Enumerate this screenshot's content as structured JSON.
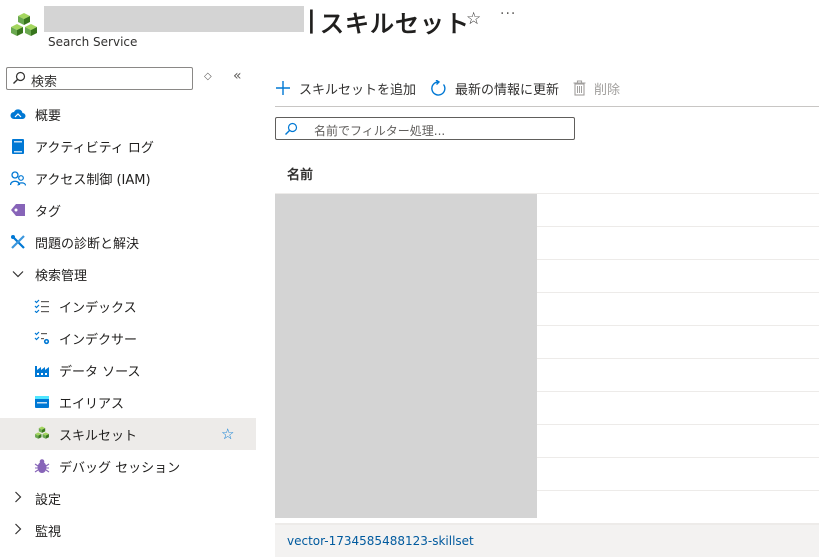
{
  "header": {
    "title": "スキルセット",
    "subtitle": "Search Service"
  },
  "sidebar": {
    "search_placeholder": "検索",
    "items": [
      {
        "label": "概要",
        "icon": "cloud-icon"
      },
      {
        "label": "アクティビティ ログ",
        "icon": "activity-log-icon"
      },
      {
        "label": "アクセス制御 (IAM)",
        "icon": "people-icon"
      },
      {
        "label": "タグ",
        "icon": "tag-icon"
      },
      {
        "label": "問題の診断と解決",
        "icon": "wrench-icon"
      },
      {
        "label": "検索管理",
        "icon": "chevron-down-icon",
        "expanded": true
      },
      {
        "label": "インデックス",
        "icon": "index-list-icon"
      },
      {
        "label": "インデクサー",
        "icon": "indexer-icon"
      },
      {
        "label": "データ ソース",
        "icon": "factory-icon"
      },
      {
        "label": "エイリアス",
        "icon": "alias-icon"
      },
      {
        "label": "スキルセット",
        "icon": "cubes-icon",
        "selected": true
      },
      {
        "label": "デバッグ セッション",
        "icon": "bug-icon"
      },
      {
        "label": "設定",
        "icon": "chevron-right-icon"
      },
      {
        "label": "監視",
        "icon": "chevron-right-icon"
      }
    ]
  },
  "toolbar": {
    "add_label": "スキルセットを追加",
    "refresh_label": "最新の情報に更新",
    "delete_label": "削除"
  },
  "filter": {
    "placeholder": "名前でフィルター処理..."
  },
  "table": {
    "column_name": "名前",
    "selected_row": "vector-1734585488123-skillset"
  },
  "colors": {
    "accent": "#0078d4",
    "link": "#005a9e",
    "selected_bg": "#edebe9",
    "redaction": "#d4d4d4"
  }
}
